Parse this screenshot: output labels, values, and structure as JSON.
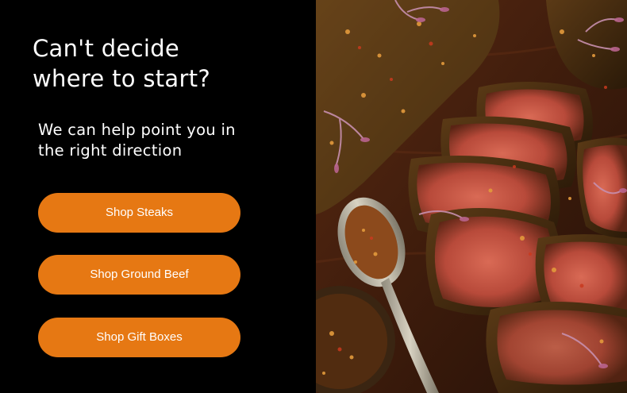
{
  "promo": {
    "headline_line1": "Can't decide",
    "headline_line2": "where to start?",
    "subtext_line1": "We can help point you in",
    "subtext_line2": "the right direction",
    "buttons": [
      {
        "label": "Shop Steaks"
      },
      {
        "label": "Shop Ground Beef"
      },
      {
        "label": "Shop Gift Boxes"
      }
    ]
  },
  "colors": {
    "background": "#000000",
    "button": "#e67813",
    "button_text": "#ffffff",
    "text": "#ffffff"
  },
  "image": {
    "subject": "sliced-steak-photo"
  }
}
